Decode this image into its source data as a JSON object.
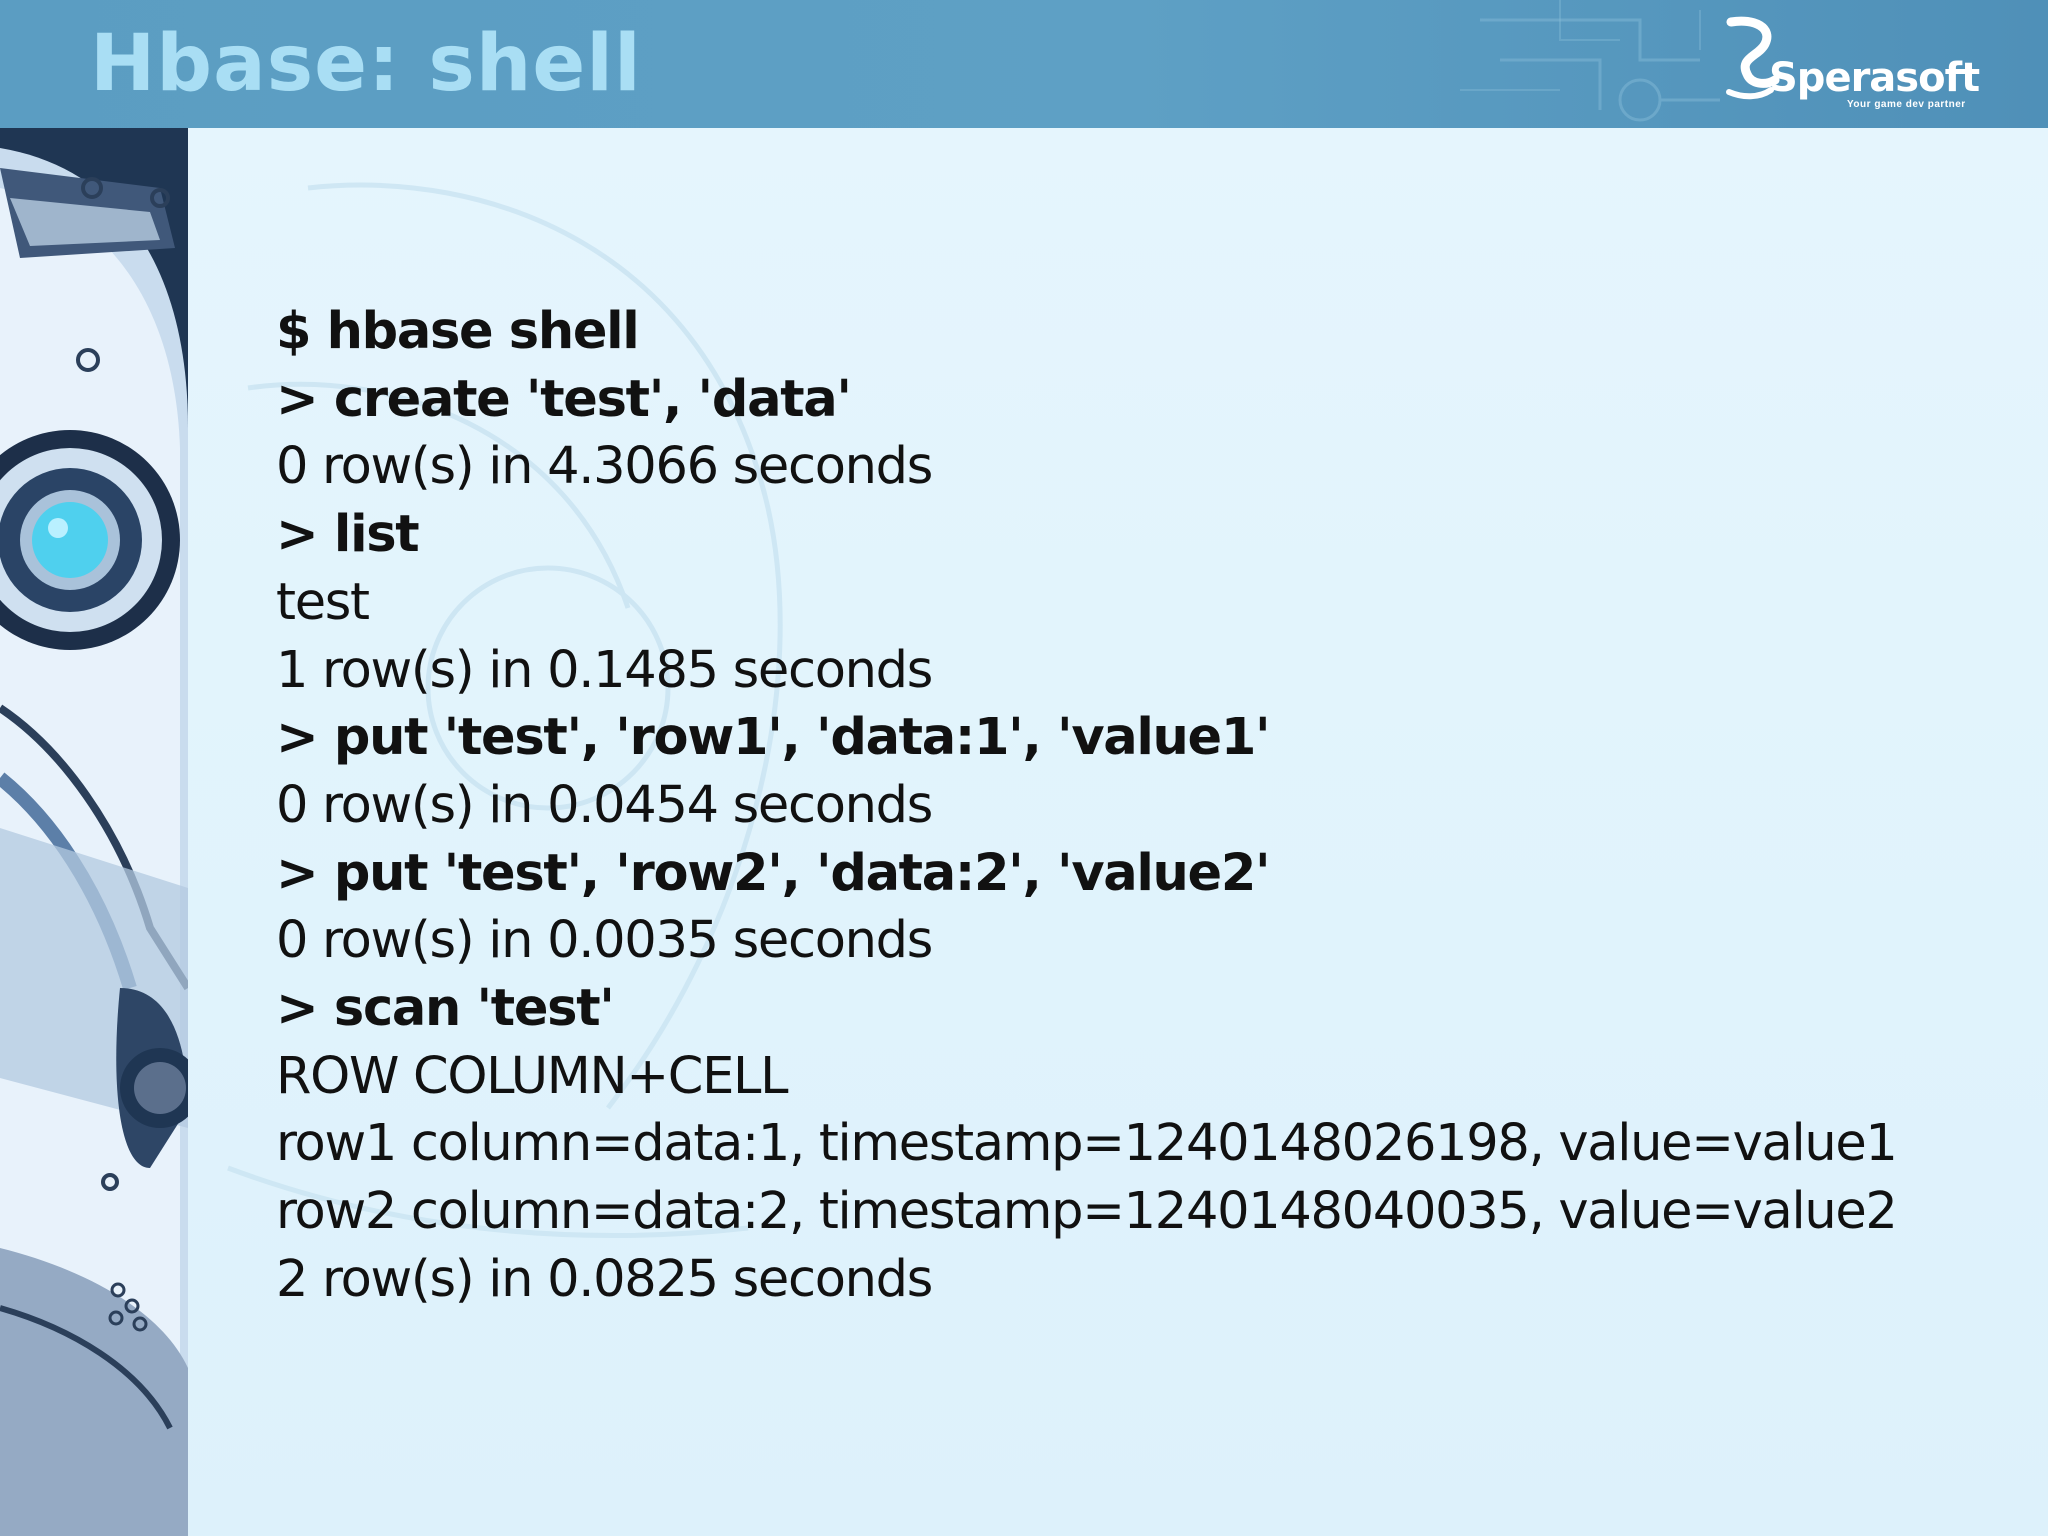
{
  "slide": {
    "title": "Hbase: shell",
    "logo": {
      "name": "Sperasoft",
      "tagline": "Your game dev partner"
    },
    "colors": {
      "header": "#5b9dc2",
      "title": "#a9def4",
      "background": "#dff1fb",
      "text": "#111111",
      "robot_eye": "#4fd0ee"
    },
    "lines": [
      {
        "text": "$ hbase shell",
        "style": "command"
      },
      {
        "text": "> create 'test', 'data'",
        "style": "command"
      },
      {
        "text": "0 row(s) in 4.3066 seconds",
        "style": "output"
      },
      {
        "text": "> list",
        "style": "command"
      },
      {
        "text": "test",
        "style": "output"
      },
      {
        "text": "1 row(s) in 0.1485 seconds",
        "style": "output"
      },
      {
        "text": "> put 'test', 'row1', 'data:1', 'value1'",
        "style": "command"
      },
      {
        "text": "0 row(s) in 0.0454 seconds",
        "style": "output"
      },
      {
        "text": "> put 'test', 'row2', 'data:2', 'value2'",
        "style": "command"
      },
      {
        "text": "0 row(s) in 0.0035 seconds",
        "style": "output"
      },
      {
        "text": "> scan 'test'",
        "style": "command"
      },
      {
        "text": "ROW COLUMN+CELL",
        "style": "output"
      },
      {
        "text": "row1 column=data:1, timestamp=1240148026198, value=value1",
        "style": "output"
      },
      {
        "text": "row2 column=data:2, timestamp=1240148040035, value=value2",
        "style": "output"
      },
      {
        "text": "2 row(s) in 0.0825 seconds",
        "style": "output"
      }
    ]
  }
}
